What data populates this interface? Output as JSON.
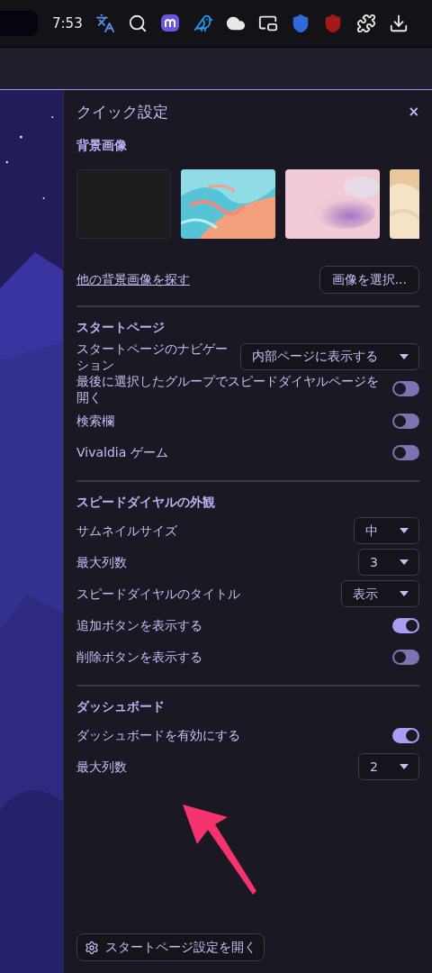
{
  "top_bar": {
    "time": "7:53"
  },
  "panel": {
    "title": "クイック設定",
    "close": "×"
  },
  "background": {
    "heading": "背景画像",
    "thumbnails": [
      {
        "kind": "empty"
      },
      {
        "kind": "marble"
      },
      {
        "kind": "gradient"
      },
      {
        "kind": "sand"
      }
    ],
    "link": "他の背景画像を探す",
    "button": "画像を選択..."
  },
  "sections": [
    {
      "heading": "スタートページ",
      "rows": [
        {
          "kind": "select",
          "label": "スタートページのナビゲーション",
          "value": "内部ページに表示する"
        },
        {
          "kind": "toggle",
          "label": "最後に選択したグループでスピードダイヤルページを開く",
          "on": false
        },
        {
          "kind": "toggle",
          "label": "検索欄",
          "on": false
        },
        {
          "kind": "toggle",
          "label": "Vivaldia ゲーム",
          "on": false
        }
      ]
    },
    {
      "heading": "スピードダイヤルの外観",
      "rows": [
        {
          "kind": "select",
          "label": "サムネイルサイズ",
          "value": "中"
        },
        {
          "kind": "select",
          "label": "最大列数",
          "value": "3"
        },
        {
          "kind": "select",
          "label": "スピードダイヤルのタイトル",
          "value": "表示"
        },
        {
          "kind": "toggle",
          "label": "追加ボタンを表示する",
          "on": true
        },
        {
          "kind": "toggle",
          "label": "削除ボタンを表示する",
          "on": false
        }
      ]
    },
    {
      "heading": "ダッシュボード",
      "rows": [
        {
          "kind": "toggle",
          "label": "ダッシュボードを有効にする",
          "on": true
        },
        {
          "kind": "select",
          "label": "最大列数",
          "value": "2"
        }
      ]
    }
  ],
  "footer_button": "スタートページ設定を開く"
}
